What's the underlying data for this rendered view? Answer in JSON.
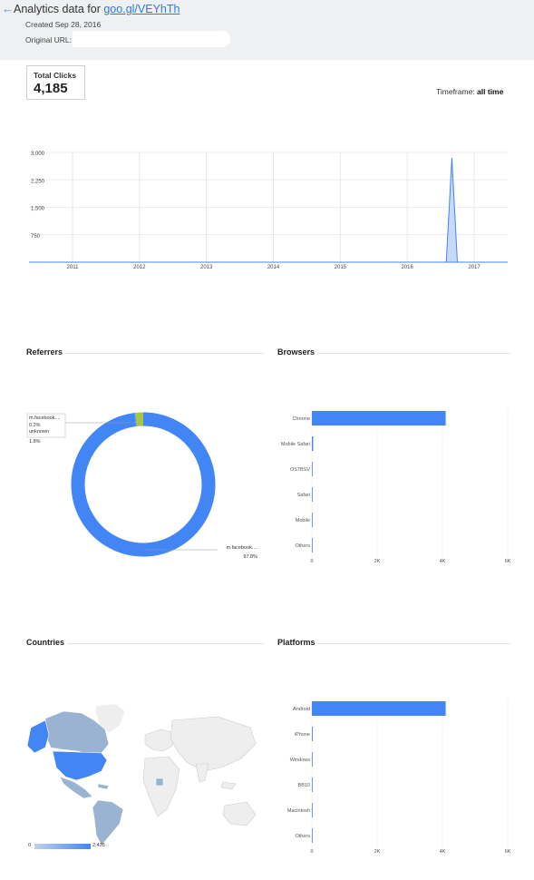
{
  "header": {
    "title_prefix": "Analytics data for ",
    "short_url": "goo.gl/VEYhTh",
    "created": "Created Sep 28, 2016",
    "original_url_label": "Original URL:"
  },
  "summary": {
    "total_clicks_label": "Total Clicks",
    "total_clicks_value": "4,185",
    "timeframe_label": "Timeframe:",
    "timeframe_value": "all time"
  },
  "colors": {
    "primary": "#4285f4",
    "secondary": "#a8c548",
    "map_light": "#99b3d1",
    "map_empty": "#eeeeee"
  },
  "sections": {
    "referrers": "Referrers",
    "browsers": "Browsers",
    "countries": "Countries",
    "platforms": "Platforms"
  },
  "chart_data": [
    {
      "type": "area",
      "title": "",
      "x_ticks": [
        "2011",
        "2012",
        "2013",
        "2014",
        "2015",
        "2016",
        "2017"
      ],
      "y_ticks": [
        "750",
        "1,500",
        "2,250",
        "3,000"
      ],
      "ylim": [
        0,
        3000
      ],
      "series": [
        {
          "points": [
            [
              "2016-08",
              0
            ],
            [
              "2016-09",
              2850
            ],
            [
              "2016-10",
              0
            ]
          ]
        }
      ]
    },
    {
      "type": "pie",
      "title": "",
      "slices": [
        {
          "label": "m.facebook....",
          "percent": "97.8%",
          "value": 97.8,
          "color": "#4285f4"
        },
        {
          "label": "m.facebook....",
          "percent": "0.2%",
          "value": 0.2,
          "color": "#4285f4"
        },
        {
          "label": "unknown",
          "percent": "1.8%",
          "value": 1.8,
          "color": "#a8c548"
        }
      ]
    },
    {
      "type": "bar",
      "title": "",
      "categories": [
        "Chrome",
        "Mobile Safari",
        "OS7BSV",
        "Safari",
        "Mobile",
        "Others"
      ],
      "values": [
        4100,
        40,
        10,
        5,
        5,
        5
      ],
      "x_ticks": [
        "0",
        "2K",
        "4K",
        "6K"
      ],
      "xlim": [
        0,
        6000
      ]
    },
    {
      "type": "bar",
      "title": "",
      "categories": [
        "Android",
        "iPhone",
        "Windows",
        "BB10",
        "Macintosh",
        "Others"
      ],
      "values": [
        4100,
        25,
        5,
        5,
        5,
        15
      ],
      "x_ticks": [
        "0",
        "2K",
        "4K",
        "6K"
      ],
      "xlim": [
        0,
        6000
      ]
    }
  ],
  "countries_legend": {
    "min": "0",
    "max": "2,435"
  }
}
